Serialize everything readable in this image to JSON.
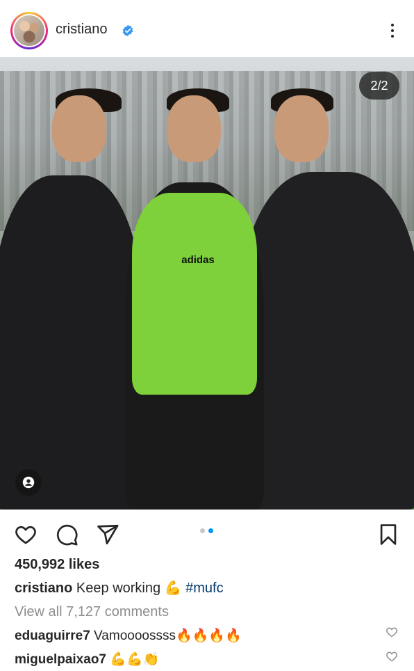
{
  "header": {
    "username": "cristiano",
    "avatar_icon": "profile-avatar",
    "verified_icon": "verified-badge-icon",
    "verified_color": "#3897f0",
    "more_icon": "more-options-icon"
  },
  "media": {
    "counter": "2/2",
    "tag_icon": "user-tag-icon",
    "carousel_index": 2,
    "carousel_total": 2,
    "vest_logo": "adidas"
  },
  "actions": {
    "like_icon": "heart-icon",
    "comment_icon": "comment-icon",
    "share_icon": "send-icon",
    "save_icon": "bookmark-icon",
    "active_dot_color": "#0095f6"
  },
  "post": {
    "likes": "450,992 likes",
    "caption_user": "cristiano",
    "caption_text": "Keep working 💪",
    "caption_hashtag": "#mufc",
    "view_all": "View all 7,127 comments",
    "hashtag_color": "#00376b"
  },
  "comments": [
    {
      "user": "eduaguirre7",
      "text": "Vamoooossss🔥🔥🔥🔥"
    },
    {
      "user": "miguelpaixao7",
      "text": "💪💪👏"
    }
  ]
}
